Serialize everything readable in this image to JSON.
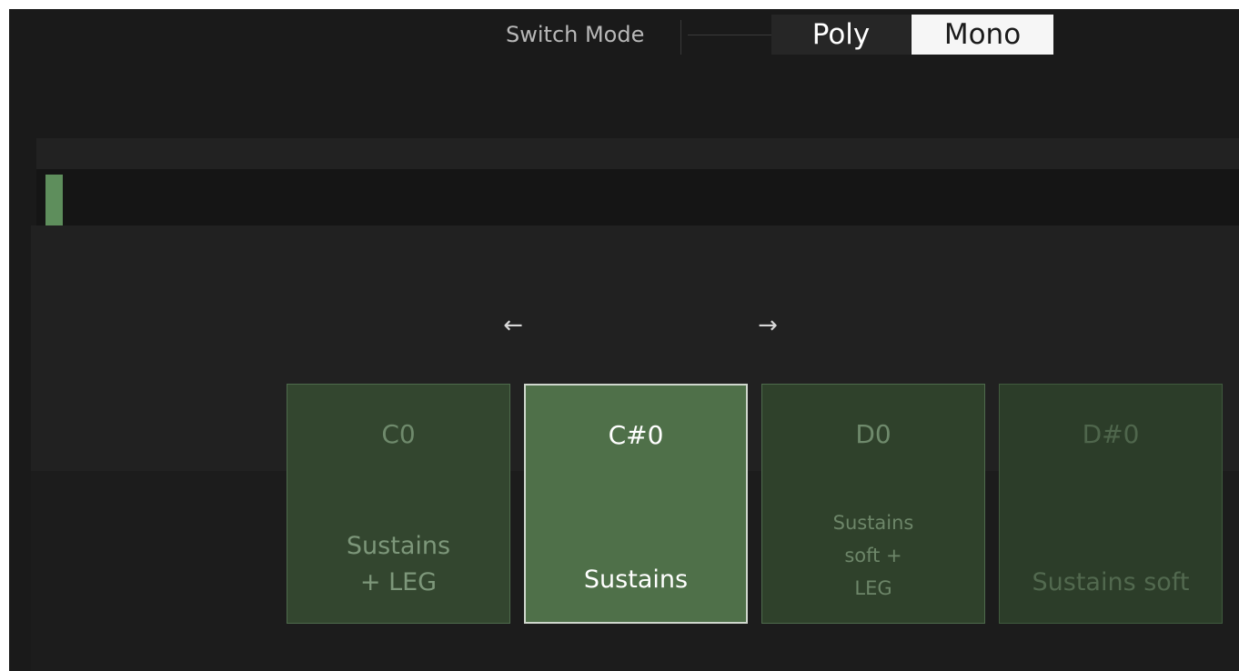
{
  "switch_mode": {
    "label": "Switch Mode",
    "options": [
      "Poly",
      "Mono"
    ],
    "selected": "Mono"
  },
  "navigation": {
    "prev_arrow": "←",
    "next_arrow": "→"
  },
  "articulations": [
    {
      "key": "C0",
      "label_lines": [
        "Sustains",
        "+ LEG"
      ],
      "state": "inactive"
    },
    {
      "key": "C#0",
      "label_lines": [
        "Sustains"
      ],
      "state": "selected"
    },
    {
      "key": "D0",
      "label_lines": [
        "Sustains",
        "soft +",
        "LEG"
      ],
      "state": "inactive"
    },
    {
      "key": "D#0",
      "label_lines": [
        "Sustains soft"
      ],
      "state": "dimmed"
    }
  ],
  "colors": {
    "background": "#1a1a1a",
    "card": "#33462f",
    "card_selected": "#4f7049",
    "indicator": "#5e8e5c",
    "segment_selected": "#f6f6f6"
  }
}
